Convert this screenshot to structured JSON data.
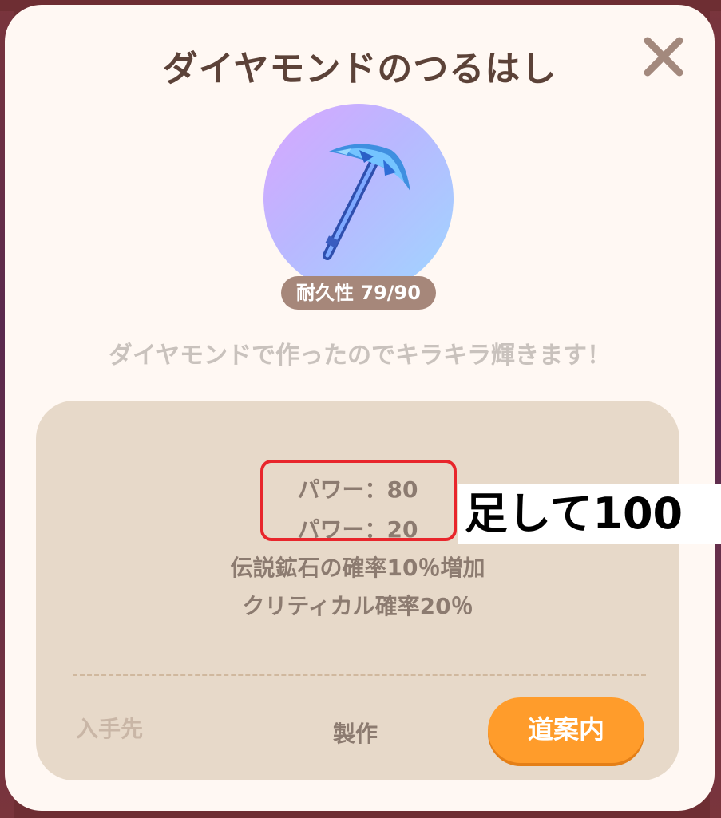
{
  "dialog": {
    "title": "ダイヤモンドのつるはし",
    "close_icon": "close-icon"
  },
  "item": {
    "icon": "diamond-pickaxe-icon",
    "durability": "耐久性 79/90",
    "description": "ダイヤモンドで作ったのでキラキラ輝きます！"
  },
  "stats": [
    "パワー：80",
    "パワー：20",
    "伝説鉱石の確率10％増加",
    "クリティカル確率20％"
  ],
  "annotation": {
    "text": "足して100",
    "box_color": "#e8262c"
  },
  "source": {
    "label": "入手先",
    "value": "製作",
    "guide_button": "道案内"
  },
  "colors": {
    "accent": "#ff9c2b",
    "title": "#5c4238",
    "panel": "#e7d9c9"
  }
}
